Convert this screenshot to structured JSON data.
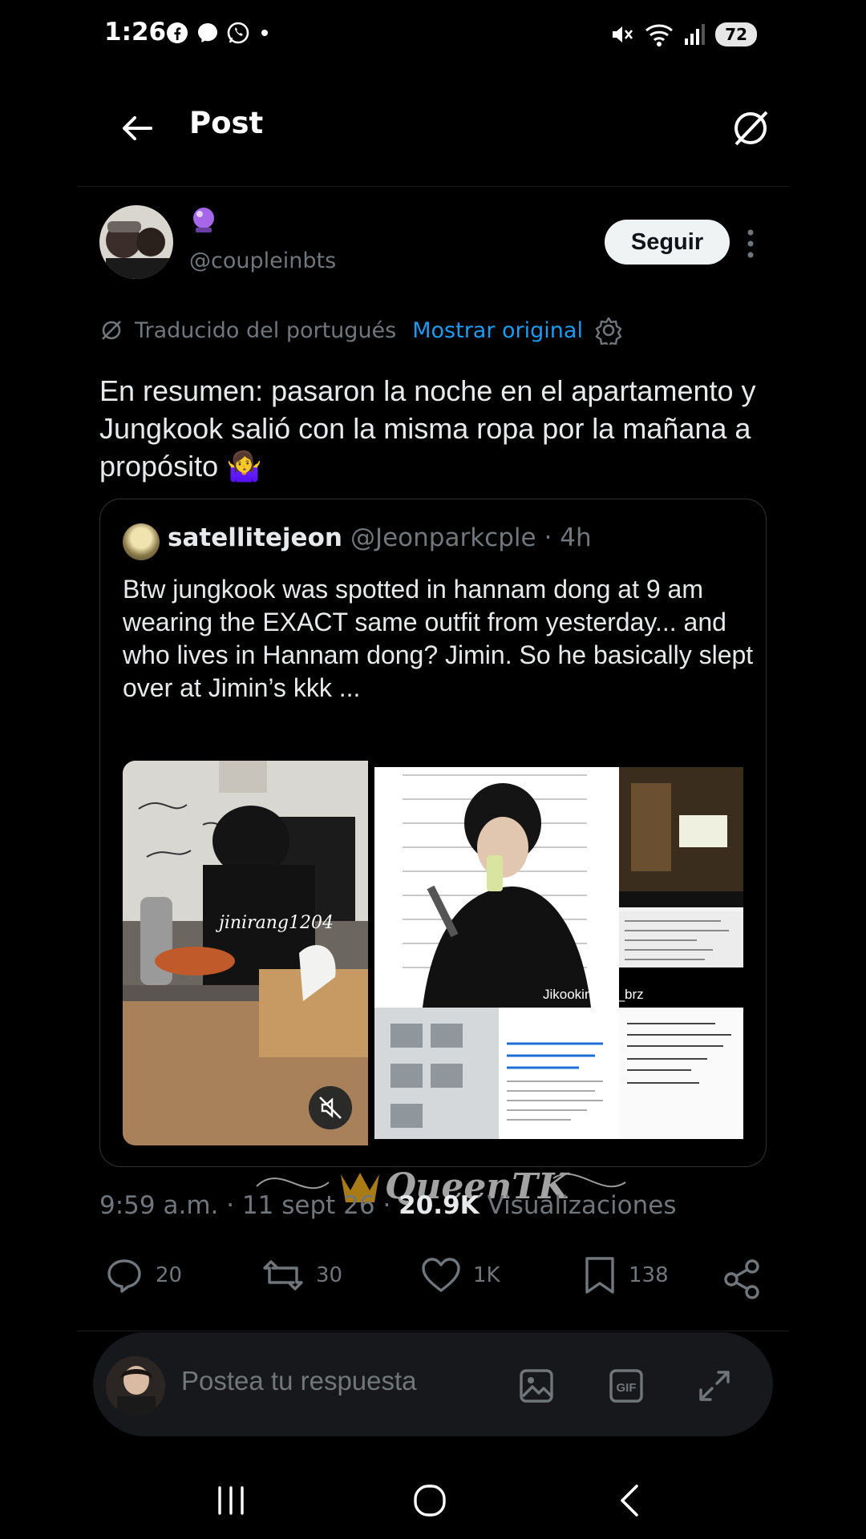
{
  "status_bar": {
    "time": "1:26",
    "battery": "72"
  },
  "header": {
    "title": "Post"
  },
  "post": {
    "handle": "@coupleinbts",
    "follow_label": "Seguir",
    "translation": {
      "label": "Traducido del portugués",
      "show_original": "Mostrar original"
    },
    "text": "En resumen: pasaron la noche en el apartamento y Jungkook salió con la misma ropa por la mañana a propósito 🤷‍♀️",
    "quote": {
      "name": "satellitejeon",
      "handle": "@Jeonparkcple",
      "time": "· 4h",
      "text": "Btw jungkook was spotted in hannam dong at 9 am wearing the EXACT same outfit from yesterday... and who lives in Hannam dong? Jimin. So he basically slept over at Jimin’s kkk ...",
      "media_watermark_1": "jinirang1204",
      "media_watermark_2": "Jikookinlove_brz"
    },
    "meta": {
      "time": "9:59 a.m.",
      "date": "· 11 sept 26 ·",
      "views_count": "20.9K",
      "views_label": "Visualizaciones"
    },
    "actions": {
      "replies": "20",
      "reposts": "30",
      "likes": "1K",
      "bookmarks": "138"
    }
  },
  "reply_box": {
    "placeholder": "Postea tu respuesta"
  },
  "colors": {
    "background": "#000000",
    "link_blue": "#1d9bf0",
    "muted_gray": "#71767b",
    "text": "#e7e9ea"
  }
}
